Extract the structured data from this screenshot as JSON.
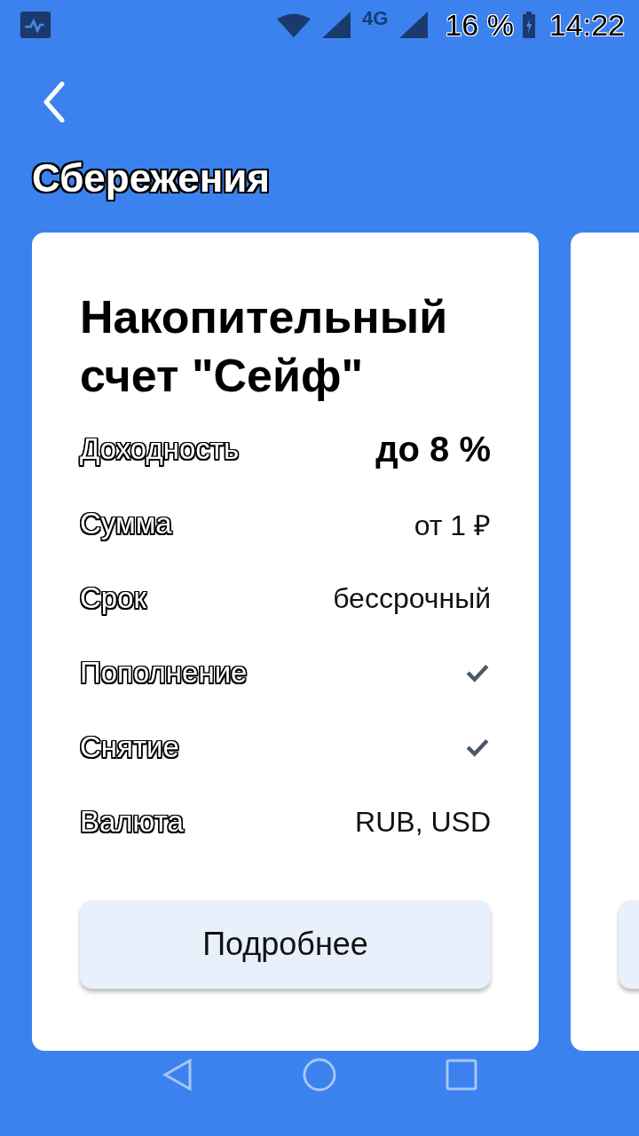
{
  "status_bar": {
    "network": "4G",
    "battery": "16 %",
    "time": "14:22"
  },
  "page": {
    "title": "Сбережения"
  },
  "cards": [
    {
      "title": "Накопительный счет \"Сейф\"",
      "rows": [
        {
          "kind": "emphasis",
          "label": "Доходность",
          "value": "до 8 %"
        },
        {
          "kind": "text",
          "label": "Сумма",
          "value": "от 1 ₽"
        },
        {
          "kind": "text",
          "label": "Срок",
          "value": "бессрочный"
        },
        {
          "kind": "check",
          "label": "Пополнение",
          "checked": true
        },
        {
          "kind": "check",
          "label": "Снятие",
          "checked": true
        },
        {
          "kind": "text",
          "label": "Валюта",
          "value": "RUB, USD"
        }
      ],
      "button": "Подробнее"
    }
  ]
}
